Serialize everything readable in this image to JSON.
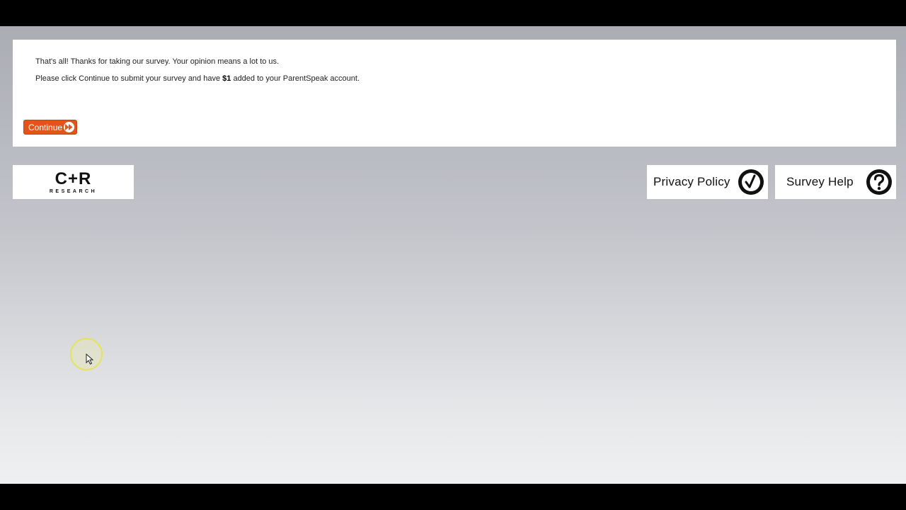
{
  "survey": {
    "message_line1": "That's all! Thanks for taking our survey. Your opinion means a lot to us.",
    "message_line2_pre": "Please click Continue to submit your survey and have ",
    "message_line2_amount": "$1",
    "message_line2_post": " added to your ParentSpeak account.",
    "continue_label": "Continue"
  },
  "footer": {
    "logo_main": "C+R",
    "logo_sub": "RESEARCH",
    "privacy_label": "Privacy Policy",
    "help_label": "Survey Help"
  },
  "colors": {
    "accent": "#e2541c",
    "cursor_highlight": "#e6e25a"
  },
  "icons": {
    "continue": "fast-forward-icon",
    "privacy": "checkmark-circle-icon",
    "help": "question-circle-icon"
  }
}
